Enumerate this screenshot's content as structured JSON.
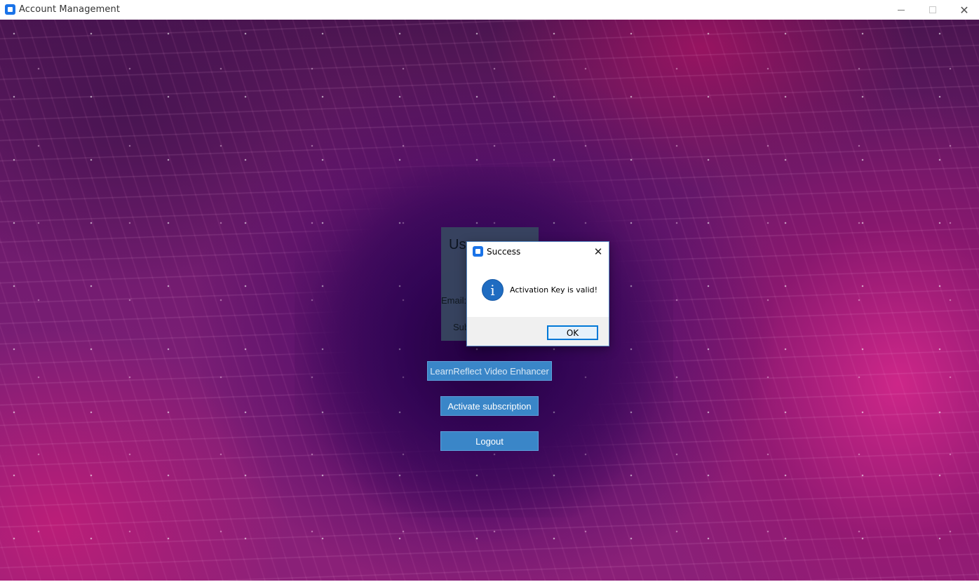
{
  "window": {
    "title": "Account Management",
    "minimize": "",
    "maximize": "",
    "close": "✕"
  },
  "panel": {
    "title_partial": "Us",
    "email_partial": "Email:",
    "sub_partial": "Sub"
  },
  "buttons": {
    "enhancer": "LearnReflect Video Enhancer",
    "activate": "Activate subscription",
    "logout": "Logout"
  },
  "dialog": {
    "title": "Success",
    "close": "✕",
    "icon": "i",
    "message": "Activation Key is valid!",
    "ok": "OK"
  },
  "colors": {
    "button_blue": "#3a86c8",
    "accent": "#0078d7",
    "info_icon": "#1f6cc1"
  }
}
